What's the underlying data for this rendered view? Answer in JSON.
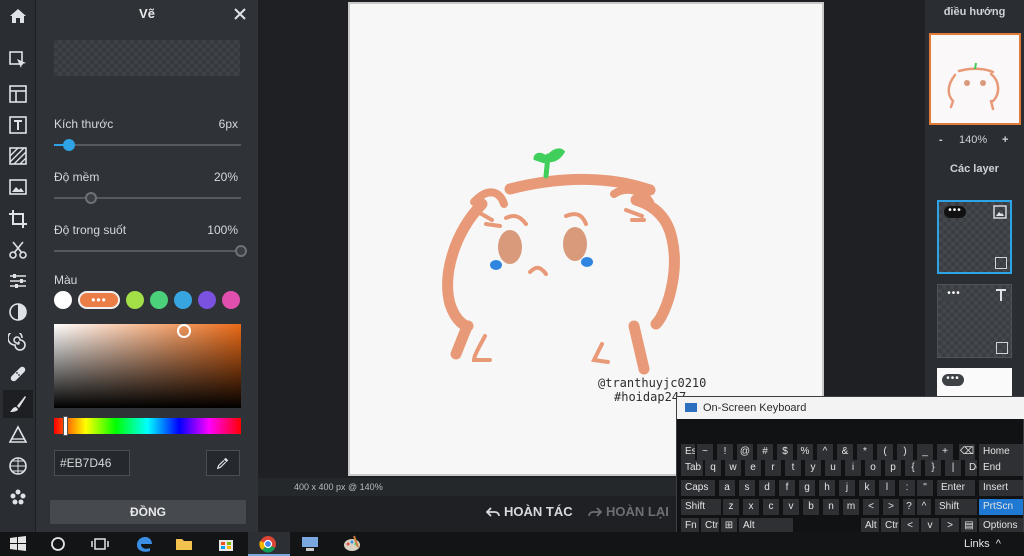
{
  "panel": {
    "title": "Vẽ",
    "size_label": "Kích thước",
    "size_value": "6px",
    "size_fraction": 0.05,
    "softness_label": "Độ mềm",
    "softness_value": "20%",
    "softness_fraction": 0.2,
    "opacity_label": "Độ trong suốt",
    "opacity_value": "100%",
    "opacity_fraction": 1.0,
    "color_label": "Màu",
    "swatches": [
      {
        "color": "#ffffff",
        "selected": false
      },
      {
        "color": "#eb7d46",
        "selected": true,
        "label": "•••"
      },
      {
        "color": "#a3e048"
      },
      {
        "color": "#4ad17a"
      },
      {
        "color": "#37a6e0"
      },
      {
        "color": "#7b52e0"
      },
      {
        "color": "#e04fae"
      }
    ],
    "hex_value": "#EB7D46",
    "done_label": "ĐỒNG"
  },
  "workspace": {
    "watermark_user": "@tranthuyjc0210",
    "watermark_tag": "#hoidap247",
    "status": "400 x 400 px @ 140%",
    "undo_label": "HOÀN TÁC",
    "redo_label": "HOÀN LẠI"
  },
  "right": {
    "nav_title": "điều hướng",
    "zoom_minus": "-",
    "zoom_value": "140%",
    "zoom_plus": "+",
    "layers_title": "Các layer",
    "layer_menu": "•••"
  },
  "keyboard": {
    "title": "On-Screen Keyboard",
    "rows": [
      [
        "Esc",
        "~",
        "!",
        "@",
        "#",
        "$",
        "%",
        "^",
        "&",
        "*",
        "(",
        ")",
        "_",
        "+",
        "⌫",
        "Home"
      ],
      [
        "Tab",
        "q",
        "w",
        "e",
        "r",
        "t",
        "y",
        "u",
        "i",
        "o",
        "p",
        "{",
        "}",
        "|",
        "Del",
        "End"
      ],
      [
        "Caps",
        "a",
        "s",
        "d",
        "f",
        "g",
        "h",
        "j",
        "k",
        "l",
        ":",
        "\"",
        "Enter",
        "Insert"
      ],
      [
        "Shift",
        "z",
        "x",
        "c",
        "v",
        "b",
        "n",
        "m",
        "<",
        ">",
        "?",
        "^",
        "Shift",
        "PrtScn"
      ],
      [
        "Fn",
        "Ctrl",
        "⊞",
        "Alt",
        "Alt",
        "Ctrl",
        "<",
        "v",
        ">",
        "▤",
        "Options"
      ]
    ]
  },
  "taskbar": {
    "links_label": "Links"
  },
  "colors": {
    "accent": "#2ea3e6",
    "brush": "#EB7D46",
    "sprout": "#3fcf5a",
    "tear": "#2f86e0"
  }
}
